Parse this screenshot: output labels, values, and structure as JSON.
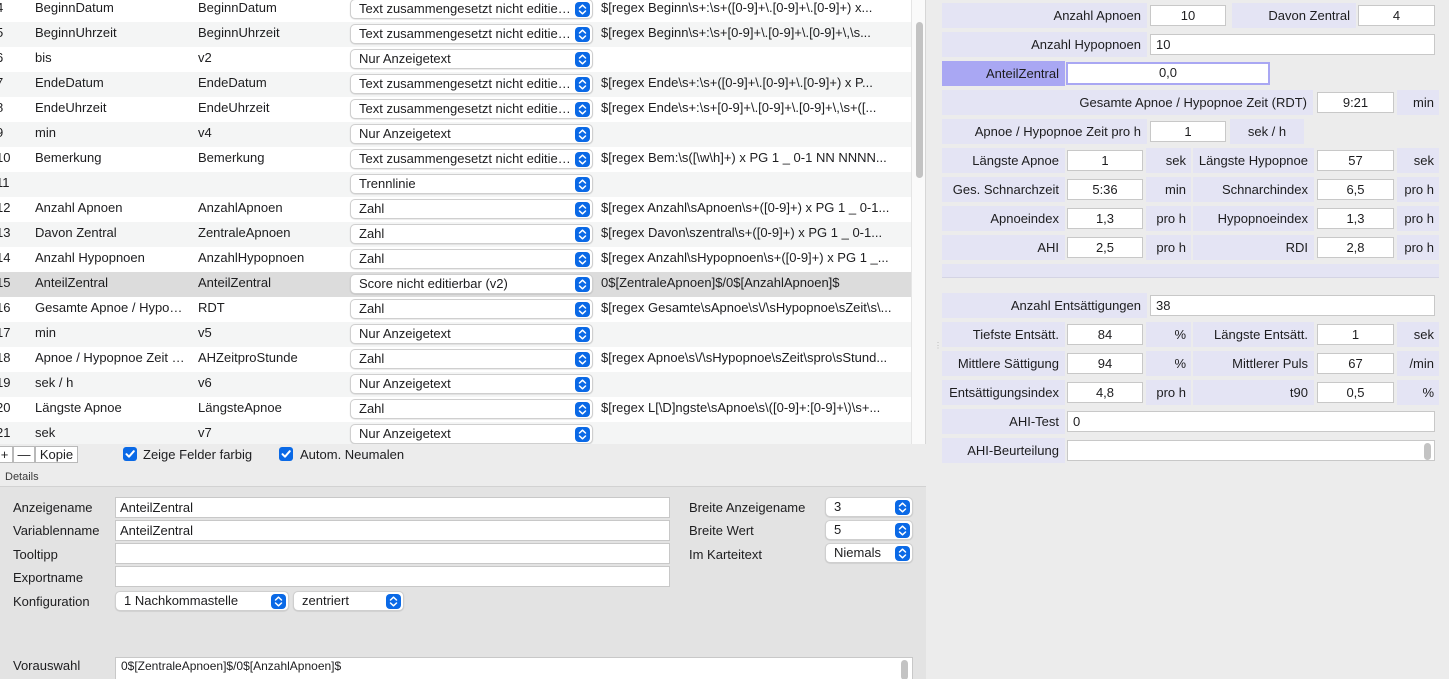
{
  "colors": {
    "accent": "#0a69e6",
    "label_bg": "#e4e4f4",
    "label_highlight": "#a9a7f3",
    "selected_row": "#dcdcdc"
  },
  "table": {
    "rows": [
      {
        "num": "4",
        "name": "BeginnDatum",
        "var": "BeginnDatum",
        "type": "Text zusammengesetzt nicht editierbar",
        "expr": "$[regex Beginn\\s+:\\s+([0-9]+\\.[0-9]+\\.[0-9]+) x..."
      },
      {
        "num": "5",
        "name": "BeginnUhrzeit",
        "var": "BeginnUhrzeit",
        "type": "Text zusammengesetzt nicht editierbar",
        "expr": "$[regex Beginn\\s+:\\s+[0-9]+\\.[0-9]+\\.[0-9]+\\,\\s..."
      },
      {
        "num": "6",
        "name": "bis",
        "var": "v2",
        "type": "Nur Anzeigetext",
        "expr": ""
      },
      {
        "num": "7",
        "name": "EndeDatum",
        "var": "EndeDatum",
        "type": "Text zusammengesetzt nicht editierbar",
        "expr": "$[regex Ende\\s+:\\s+([0-9]+\\.[0-9]+\\.[0-9]+) x P..."
      },
      {
        "num": "8",
        "name": "EndeUhrzeit",
        "var": "EndeUhrzeit",
        "type": "Text zusammengesetzt nicht editierbar",
        "expr": "$[regex Ende\\s+:\\s+[0-9]+\\.[0-9]+\\.[0-9]+\\,\\s+([..."
      },
      {
        "num": "9",
        "name": "min",
        "var": "v4",
        "type": "Nur Anzeigetext",
        "expr": ""
      },
      {
        "num": "10",
        "name": "Bemerkung",
        "var": "Bemerkung",
        "type": "Text zusammengesetzt nicht editierbar",
        "expr": "$[regex Bem:\\s([\\w\\h]+) x PG 1 _ 0-1 NN NNNN..."
      },
      {
        "num": "11",
        "name": "",
        "var": "",
        "type": "Trennlinie",
        "expr": ""
      },
      {
        "num": "12",
        "name": "Anzahl Apnoen",
        "var": "AnzahlApnoen",
        "type": "Zahl",
        "expr": "$[regex Anzahl\\sApnoen\\s+([0-9]+) x PG 1 _ 0-1..."
      },
      {
        "num": "13",
        "name": "Davon Zentral",
        "var": "ZentraleApnoen",
        "type": "Zahl",
        "expr": "$[regex Davon\\szentral\\s+([0-9]+) x PG 1 _ 0-1..."
      },
      {
        "num": "14",
        "name": "Anzahl Hypopnoen",
        "var": "AnzahlHypopnoen",
        "type": "Zahl",
        "expr": "$[regex Anzahl\\sHypopnoen\\s+([0-9]+) x PG 1 _..."
      },
      {
        "num": "15",
        "name": "AnteilZentral",
        "var": "AnteilZentral",
        "type": "Score nicht editierbar (v2)",
        "expr": "0$[ZentraleApnoen]$/0$[AnzahlApnoen]$"
      },
      {
        "num": "16",
        "name": "Gesamte Apnoe / Hypopnoe Zeit (RDT)",
        "var": "RDT",
        "type": "Zahl",
        "expr": "$[regex Gesamte\\sApnoe\\s\\/\\sHypopnoe\\sZeit\\s\\..."
      },
      {
        "num": "17",
        "name": "min",
        "var": "v5",
        "type": "Nur Anzeigetext",
        "expr": ""
      },
      {
        "num": "18",
        "name": "Apnoe / Hypopnoe Zeit pro h",
        "var": "AHZeitproStunde",
        "type": "Zahl",
        "expr": "$[regex Apnoe\\s\\/\\sHypopnoe\\sZeit\\spro\\sStund..."
      },
      {
        "num": "19",
        "name": "sek / h",
        "var": "v6",
        "type": "Nur Anzeigetext",
        "expr": ""
      },
      {
        "num": "20",
        "name": "Längste Apnoe",
        "var": "LängsteApnoe",
        "type": "Zahl",
        "expr": "$[regex L[\\D]ngste\\sApnoe\\s\\([0-9]+:[0-9]+\\)\\s+..."
      },
      {
        "num": "21",
        "name": "sek",
        "var": "v7",
        "type": "Nur Anzeigetext",
        "expr": ""
      }
    ],
    "selected_index": 11
  },
  "toolbar": {
    "add_label": "+",
    "remove_label": "—",
    "copy_label": "Kopie",
    "show_colored_label": "Zeige Felder farbig",
    "auto_repaint_label": "Autom. Neumalen"
  },
  "details": {
    "title": "Details",
    "display_name_label": "Anzeigename",
    "display_name_value": "AnteilZentral",
    "variable_name_label": "Variablenname",
    "variable_name_value": "AnteilZentral",
    "tooltip_label": "Tooltipp",
    "tooltip_value": "",
    "export_name_label": "Exportname",
    "export_name_value": "",
    "config_label": "Konfiguration",
    "decimals_value": "1 Nachkommastelle",
    "alignment_value": "zentriert",
    "width_name_label": "Breite Anzeigename",
    "width_name_value": "3",
    "width_value_label": "Breite Wert",
    "width_value_value": "5",
    "card_text_label": "Im Karteitext",
    "card_text_value": "Niemals",
    "preselect_label": "Vorauswahl",
    "preselect_value": "0$[ZentraleApnoen]$/0$[AnzahlApnoen]$"
  },
  "form": {
    "anzahl_apnoen_label": "Anzahl Apnoen",
    "anzahl_apnoen_value": "10",
    "davon_zentral_label": "Davon Zentral",
    "davon_zentral_value": "4",
    "anzahl_hypopnoen_label": "Anzahl Hypopnoen",
    "anzahl_hypopnoen_value": "10",
    "anteil_zentral_label": "AnteilZentral",
    "anteil_zentral_value": "0,0",
    "rdt_label": "Gesamte Apnoe / Hypopnoe Zeit (RDT)",
    "rdt_value": "9:21",
    "rdt_unit": "min",
    "ah_zeit_label": "Apnoe / Hypopnoe Zeit pro h",
    "ah_zeit_value": "1",
    "ah_zeit_unit": "sek / h",
    "laengste_apnoe_label": "Längste Apnoe",
    "laengste_apnoe_value": "1",
    "laengste_apnoe_unit": "sek",
    "laengste_hypopnoe_label": "Längste Hypopnoe",
    "laengste_hypopnoe_value": "57",
    "laengste_hypopnoe_unit": "sek",
    "schnarchzeit_label": "Ges. Schnarchzeit",
    "schnarchzeit_value": "5:36",
    "schnarchzeit_unit": "min",
    "schnarchindex_label": "Schnarchindex",
    "schnarchindex_value": "6,5",
    "schnarchindex_unit": "pro h",
    "apnoeindex_label": "Apnoeindex",
    "apnoeindex_value": "1,3",
    "apnoeindex_unit": "pro h",
    "hypopnoeindex_label": "Hypopnoeindex",
    "hypopnoeindex_value": "1,3",
    "hypopnoeindex_unit": "pro h",
    "ahi_label": "AHI",
    "ahi_value": "2,5",
    "ahi_unit": "pro h",
    "rdi_label": "RDI",
    "rdi_value": "2,8",
    "rdi_unit": "pro h",
    "entsaettigungen_label": "Anzahl Entsättigungen",
    "entsaettigungen_value": "38",
    "tiefste_label": "Tiefste Entsätt.",
    "tiefste_value": "84",
    "tiefste_unit": "%",
    "laengste_ents_label": "Längste Entsätt.",
    "laengste_ents_value": "1",
    "laengste_ents_unit": "sek",
    "mittlere_saett_label": "Mittlere Sättigung",
    "mittlere_saett_value": "94",
    "mittlere_saett_unit": "%",
    "mittlerer_puls_label": "Mittlerer Puls",
    "mittlerer_puls_value": "67",
    "mittlerer_puls_unit": "/min",
    "ents_index_label": "Entsättigungsindex",
    "ents_index_value": "4,8",
    "ents_index_unit": "pro h",
    "t90_label": "t90",
    "t90_value": "0,5",
    "t90_unit": "%",
    "ahi_test_label": "AHI-Test",
    "ahi_test_value": "0",
    "ahi_beurteilung_label": "AHI-Beurteilung",
    "ahi_beurteilung_value": ""
  }
}
